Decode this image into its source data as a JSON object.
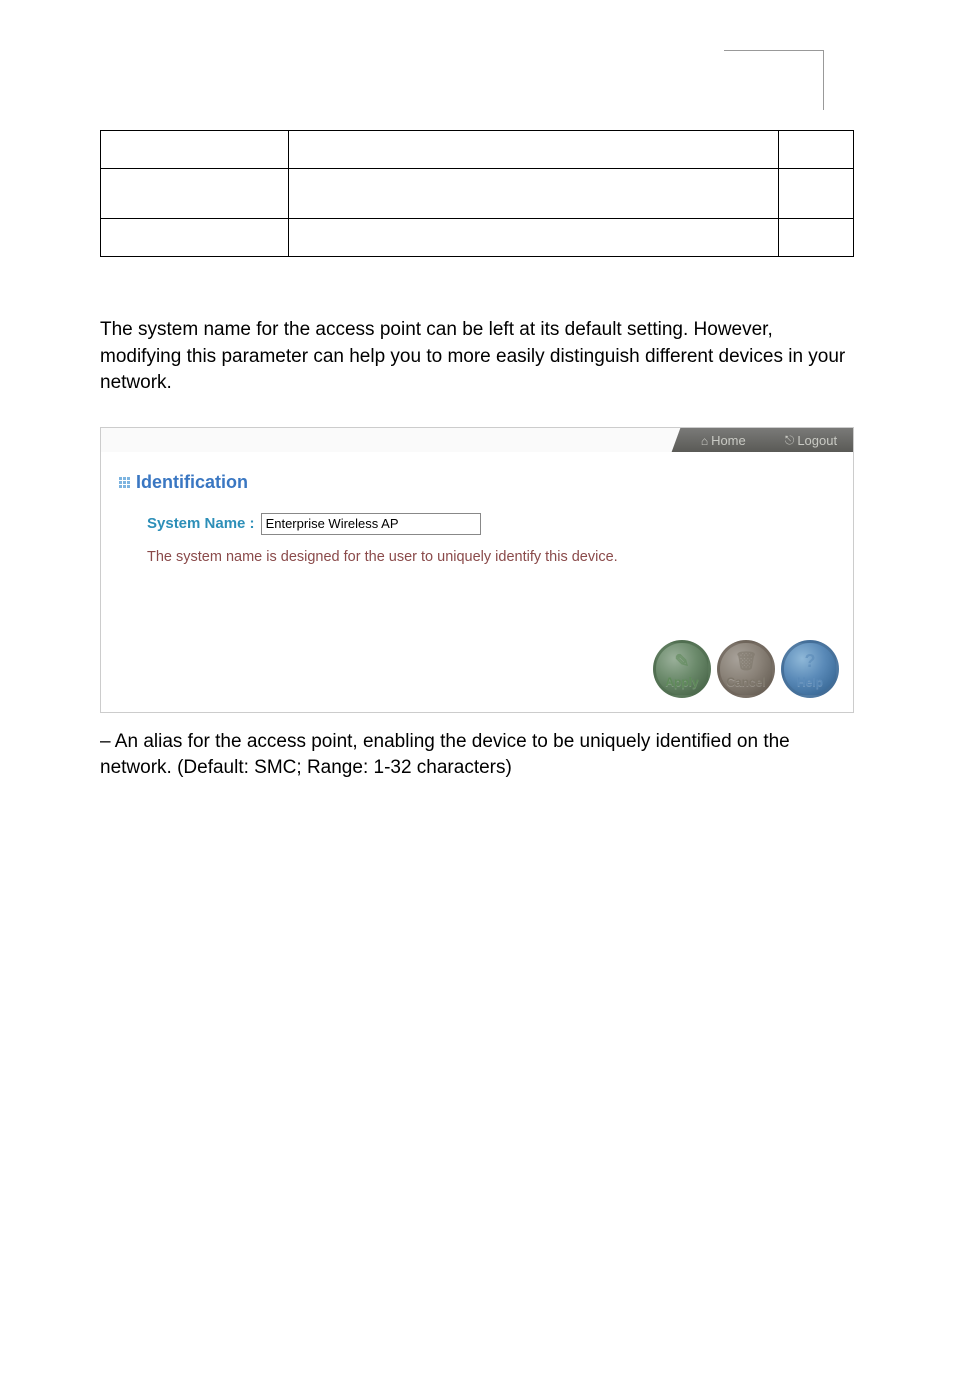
{
  "intro_text": "The system name for the access point can be left at its default setting. However, modifying this parameter can help you to more easily distinguish different devices in your network.",
  "panel": {
    "tabs": {
      "home": "Home",
      "logout": "Logout"
    },
    "section_title": "Identification",
    "system_name_label": "System Name :",
    "system_name_value": "Enterprise Wireless AP",
    "helper": "The system name is designed for the user to uniquely identify this device.",
    "buttons": {
      "apply": "Apply",
      "cancel": "Cancel",
      "help": "Help"
    }
  },
  "footer_text": " – An alias for the access point, enabling the device to be uniquely identified on the network. (Default: SMC; Range: 1-32 characters)"
}
